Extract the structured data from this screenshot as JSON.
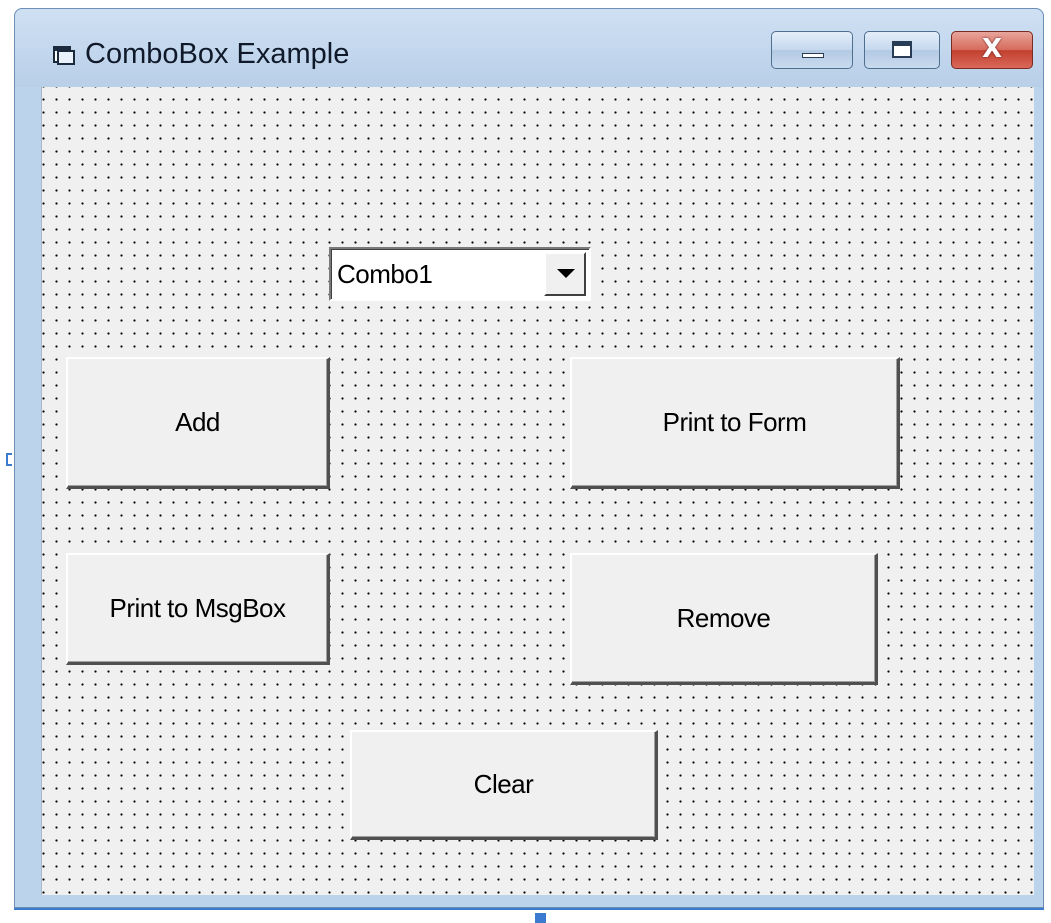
{
  "window": {
    "title": "ComboBox Example",
    "controls": [
      "minimize",
      "maximize",
      "close"
    ],
    "close_glyph": "X"
  },
  "form": {
    "combo": {
      "text": "Combo1"
    },
    "buttons": {
      "add": "Add",
      "print_to_form": "Print to Form",
      "print_to_msgbox": "Print to MsgBox",
      "remove": "Remove",
      "clear": "Clear"
    }
  },
  "icons": {
    "app": "form-icon",
    "dropdown": "chevron-down-icon"
  },
  "colors": {
    "form_background": "#f0f0f0",
    "titlebar": "#bcd3ec",
    "close_button": "#c2402f",
    "selection_handle": "#3c7ad0"
  }
}
